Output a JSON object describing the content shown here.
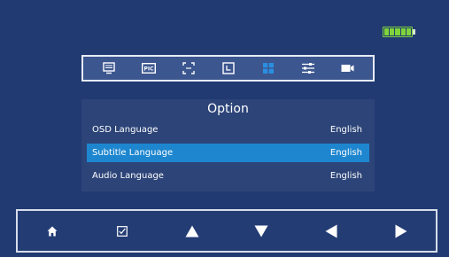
{
  "battery": {
    "level": 1.0,
    "color": "#7fd43a"
  },
  "toolbar": {
    "icons": [
      "display-icon",
      "picture-icon",
      "aspect-ratio-icon",
      "timer-icon",
      "grid-icon",
      "settings-sliders-icon",
      "video-input-icon"
    ],
    "pic_text": "PIC",
    "selected": "grid-icon"
  },
  "menu": {
    "title": "Option",
    "rows": [
      {
        "label": "OSD Language",
        "value": "English"
      },
      {
        "label": "Subtitle Language",
        "value": "English",
        "selected": true
      },
      {
        "label": "Audio Language",
        "value": "English"
      }
    ]
  },
  "navbar": {
    "buttons": [
      "home-icon",
      "checkbox-icon",
      "up-arrow-icon",
      "down-arrow-icon",
      "left-arrow-icon",
      "right-arrow-icon"
    ]
  },
  "colors": {
    "background": "#213a72",
    "selection": "#1e86cf",
    "accent": "#2a8fe0"
  }
}
